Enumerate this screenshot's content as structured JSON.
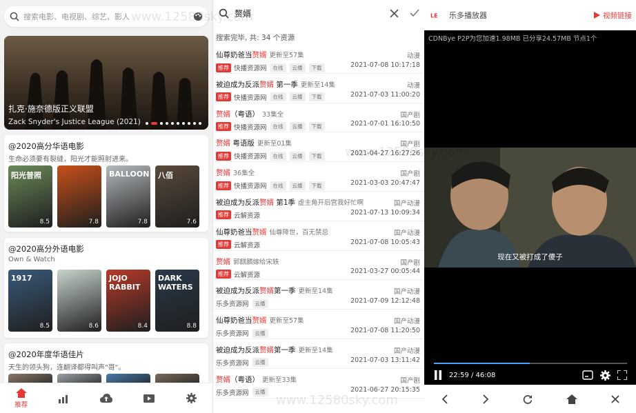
{
  "panel1": {
    "search_placeholder": "搜索电影、电视剧、综艺、影人",
    "banner": {
      "title_cn": "扎克·施奈德版正义联盟",
      "title_en": "Zack Snyder's Justice League (2021)"
    },
    "sections": [
      {
        "title": "@2020高分华语电影",
        "subtitle": "生命必须要有裂缝，阳光才能照射进来。",
        "posters": [
          {
            "title": "阳光普照",
            "score": "8.5",
            "color": "#6a8a5a"
          },
          {
            "title": "",
            "score": "7.8",
            "color": "#c8501a"
          },
          {
            "title": "BALLOON",
            "score": "7.8",
            "color": "#b4b9bc"
          },
          {
            "title": "八佰",
            "score": "7.6",
            "color": "#5a4a3a"
          }
        ]
      },
      {
        "title": "@2020高分外语电影",
        "subtitle": "Own & Watch",
        "posters": [
          {
            "title": "1917",
            "score": "8.5",
            "color": "#3a5a7a"
          },
          {
            "title": "",
            "score": "8.6",
            "color": "#c8d4cc"
          },
          {
            "title": "JOJO RABBIT",
            "score": "8.4",
            "color": "#b73a2a"
          },
          {
            "title": "DARK WATERS",
            "score": "8.8",
            "color": "#2a3a4a"
          }
        ]
      },
      {
        "title": "@2020年度华语佳片",
        "subtitle": "天生的领头狗，连翻译都得叫声\"哥\"。",
        "posters": [
          {
            "title": "",
            "score": "",
            "color": "#8a7a6a"
          },
          {
            "title": "",
            "score": "",
            "color": "#9aa0a8"
          },
          {
            "title": "",
            "score": "",
            "color": "#4a7aaa"
          },
          {
            "title": "",
            "score": "",
            "color": "#7a6a5a"
          }
        ]
      }
    ],
    "nav": [
      {
        "label": "推荐",
        "icon": "home-icon"
      },
      {
        "label": "",
        "icon": "ranking-icon"
      },
      {
        "label": "",
        "icon": "cloud-upload-icon"
      },
      {
        "label": "",
        "icon": "video-icon"
      },
      {
        "label": "",
        "icon": "settings-icon"
      }
    ]
  },
  "panel2": {
    "query": "赘婿",
    "status": "搜索完毕, 共: 34 个资源",
    "results": [
      {
        "pre": "仙尊奶爸当",
        "kw": "赘婿",
        "post": "",
        "update": "更新至57集",
        "category": "动漫",
        "rec": true,
        "source": "快播资源网",
        "tags": [
          "在线",
          "云播",
          "下载"
        ],
        "date": "2021-07-08 10:17:18"
      },
      {
        "pre": "被迫成为反派",
        "kw": "赘婿",
        "post": " 第一季",
        "update": "更新至14集",
        "category": "动漫",
        "rec": true,
        "source": "快播资源网",
        "tags": [
          "在线",
          "云播",
          "下载"
        ],
        "date": "2021-07-03 11:00:20"
      },
      {
        "pre": "",
        "kw": "赘婿",
        "post": "（粤语）",
        "update": "33集全",
        "category": "国产剧",
        "rec": true,
        "source": "快播资源网",
        "tags": [
          "在线",
          "云播",
          "下载"
        ],
        "date": "2021-07-01 16:10:50"
      },
      {
        "pre": "",
        "kw": "赘婿",
        "post": " 粤语版",
        "update": "更新至01集",
        "category": "国产剧",
        "rec": true,
        "source": "快播资源网",
        "tags": [
          "在线",
          "云播",
          "下载"
        ],
        "date": "2021-04-27 16:27:26"
      },
      {
        "pre": "",
        "kw": "赘婿",
        "post": "",
        "update": "36集全",
        "category": "国产剧",
        "rec": true,
        "source": "快播资源网",
        "tags": [
          "在线",
          "云播",
          "下载"
        ],
        "date": "2021-03-03 20:47:47"
      },
      {
        "pre": "被迫成为反派",
        "kw": "赘婿",
        "post": " 第1季",
        "update": "虚主角开后宫我好忙啊",
        "category": "国产动漫",
        "rec": true,
        "source": "云解资源",
        "tags": [],
        "date": "2021-07-13 10:09:34"
      },
      {
        "pre": "仙尊奶爸当",
        "kw": "赘婿",
        "post": "",
        "update": "仙尊降世，百无禁忌",
        "category": "国产动漫",
        "rec": true,
        "source": "云解资源",
        "tags": [],
        "date": "2021-07-08 10:05:43"
      },
      {
        "pre": "",
        "kw": "赘婿",
        "post": "",
        "update": "郭麒麟嫁给宋轶",
        "category": "国产剧",
        "rec": true,
        "source": "云解资源",
        "tags": [],
        "date": "2021-03-27 00:05:44"
      },
      {
        "pre": "被迫成为反派",
        "kw": "赘婿",
        "post": "第一季",
        "update": "更新至14集",
        "category": "国产动漫",
        "rec": false,
        "source": "乐多资源网",
        "tags": [
          "云播"
        ],
        "date": "2021-07-09 12:12:48"
      },
      {
        "pre": "仙尊奶爸当",
        "kw": "赘婿",
        "post": "",
        "update": "更新至57集",
        "category": "国产动漫",
        "rec": false,
        "source": "乐多资源网",
        "tags": [
          "云播"
        ],
        "date": "2021-07-08 11:20:50"
      },
      {
        "pre": "被迫成为反派",
        "kw": "赘婿",
        "post": "第一季",
        "update": "更新至14集",
        "category": "国产动漫",
        "rec": false,
        "source": "乐多资源网",
        "tags": [
          "云播"
        ],
        "date": "2021-07-03 13:11:42"
      },
      {
        "pre": "",
        "kw": "赘婿",
        "post": "（粤语）",
        "update": "更新至33集",
        "category": "国产剧",
        "rec": false,
        "source": "乐多资源网",
        "tags": [
          "云播"
        ],
        "date": "2021-06-27 20:15:35"
      }
    ]
  },
  "panel3": {
    "title": "乐多播放器",
    "link_label": "视频链接",
    "cdn_status": "CDNBye P2P为您加速1.98MB 已分享24.57MB 节点1个",
    "subtitle": "现在又被打成了傻子",
    "time": "22:59 / 46:08",
    "progress": 0.498
  },
  "watermark": "www.12580sky.com"
}
